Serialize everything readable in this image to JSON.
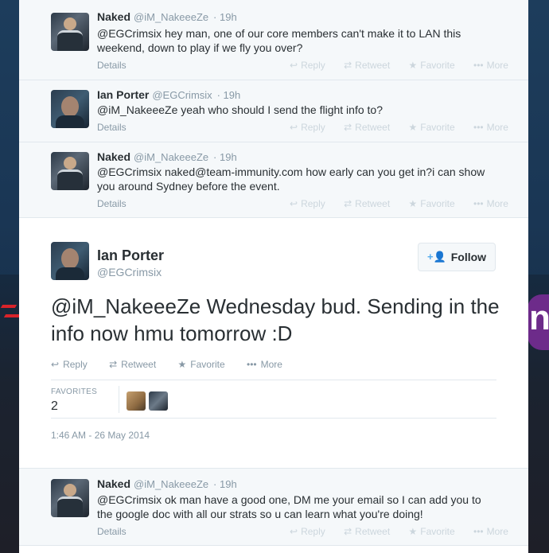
{
  "background": {
    "partial_logo_text": "n"
  },
  "tweets_above": [
    {
      "name": "Naked",
      "handle": "@iM_NakeeeZe",
      "time": "· 19h",
      "text": "@EGCrimsix hey man, one of our core members can't make it to LAN this weekend, down to play if we fly you over?",
      "avatar": "naked"
    },
    {
      "name": "Ian Porter",
      "handle": "@EGCrimsix",
      "time": "· 19h",
      "text": "@iM_NakeeeZe yeah who should I send the flight info to?",
      "avatar": "ian"
    },
    {
      "name": "Naked",
      "handle": "@iM_NakeeeZe",
      "time": "· 19h",
      "text": "@EGCrimsix naked@team-immunity.com how early can you get in?i can show you around Sydney before the event.",
      "avatar": "naked"
    }
  ],
  "tweet_actions": {
    "details": "Details",
    "reply": "Reply",
    "retweet": "Retweet",
    "favorite": "Favorite",
    "more": "More"
  },
  "icons": {
    "reply": "reply-arrow-icon",
    "retweet": "retweet-icon",
    "favorite": "star-icon",
    "more": "ellipsis-icon",
    "follow": "add-user-icon"
  },
  "main_tweet": {
    "name": "Ian Porter",
    "handle": "@EGCrimsix",
    "follow_label": "Follow",
    "text": "@iM_NakeeeZe Wednesday bud. Sending in the info now hmu tomorrow :D",
    "actions": {
      "reply": "Reply",
      "retweet": "Retweet",
      "favorite": "Favorite",
      "more": "More"
    },
    "favorites_label": "FAVORITES",
    "favorites_count": "2",
    "timestamp": "1:46 AM - 26 May 2014"
  },
  "reply_tweet": {
    "name": "Naked",
    "handle": "@iM_NakeeeZe",
    "time": "· 19h",
    "text": "@EGCrimsix ok man have a good one, DM me your email so I can add you to the google doc with all our strats so u can learn what you're doing!"
  },
  "colors": {
    "link_blue": "#55acee",
    "text": "#292f33",
    "muted": "#8899a6",
    "action_faded": "#ccd6dd"
  }
}
